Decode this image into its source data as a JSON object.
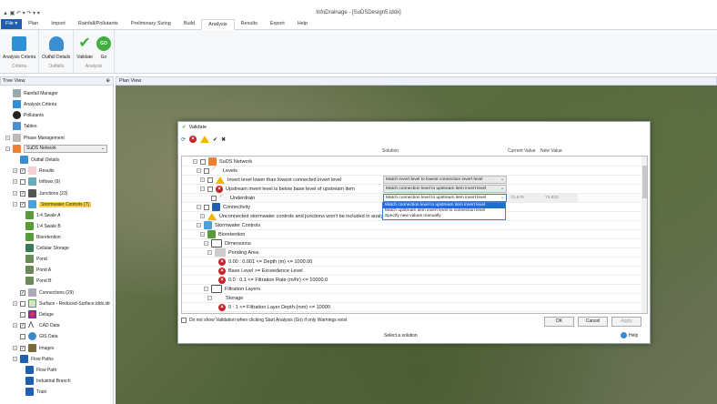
{
  "window": {
    "title": "InfoDrainage - [SuDSDesign5.iddx]"
  },
  "ribbon": {
    "tabs": [
      "File",
      "Plan",
      "Import",
      "Rainfall/Pollutants",
      "Preliminary Sizing",
      "Build",
      "Analysis",
      "Results",
      "Export",
      "Help"
    ],
    "active_tab": "Analysis",
    "groups": [
      {
        "label": "Criteria",
        "buttons": [
          "Analysis Criteria"
        ]
      },
      {
        "label": "Outfalls",
        "buttons": [
          "Outfall Details"
        ]
      },
      {
        "label": "Analysis",
        "buttons": [
          "Validate",
          "Go"
        ]
      }
    ]
  },
  "tree": {
    "header": "Tree View",
    "items": [
      "Rainfall Manager",
      "Analysis Criteria",
      "Pollutants",
      "Tables",
      "Phase Management",
      "SuDS Network",
      "Outfall Details",
      "Results",
      "Inflows (9)",
      "Junctions (23)",
      "Stormwater Controls (7)",
      "1:4 Swale A",
      "1:4 Swale B",
      "Bioretention",
      "Cellular Storage",
      "Pond",
      "Pond A",
      "Pond B",
      "Connections (29)",
      "Surface - Reduced-Surface.iddx.idr",
      "Deluge",
      "CAD Data",
      "GIS Data",
      "Images",
      "Flow Paths",
      "Flow Path",
      "Industrial Branch",
      "Train"
    ]
  },
  "plan": {
    "header": "Plan View"
  },
  "dialog": {
    "title": "Validate",
    "columns": {
      "solution": "Solution",
      "current": "Current Value",
      "new": "New Value"
    },
    "rows": [
      "SuDS Network",
      "Levels",
      "Invert level lower than lowest connected invert level",
      "Upstream invert level is below base level of upstream item",
      "Underdrain",
      "Connectivity",
      "Unconnected stormwater controls and junctions won't be included in analysis",
      "Stormwater Controls",
      "Bioretention",
      "Dimensions",
      "Ponding Area",
      "0.00 : 0.001 <= Depth (m) <= 1000.00",
      "Base Level >= Exceedence Level",
      "0.0 : 0.1 <= Filtration Rate (m/hr) <= 10000.0",
      "Filtration Layers",
      "Storage",
      "0 : 1 <= Filtration Layer Depth (mm) <= 10000"
    ],
    "solutions": [
      "Match invert level to lowest connection invert level",
      "Match connection level to upstream item invert level",
      "Match connection level to upstream item invert level"
    ],
    "current_value": "71.676",
    "new_value": "73.823",
    "dropdown_options": [
      "Match connection level to upstream item invert level",
      "Match upstream item invert level to connection level",
      "Specify new values manually"
    ],
    "checkbox_label": "Do not show Validation when clicking Start Analysis (Go) if only Warnings exist",
    "buttons": {
      "ok": "OK",
      "cancel": "Cancel",
      "apply": "Apply"
    },
    "status": "Select a solution",
    "help": "Help"
  }
}
